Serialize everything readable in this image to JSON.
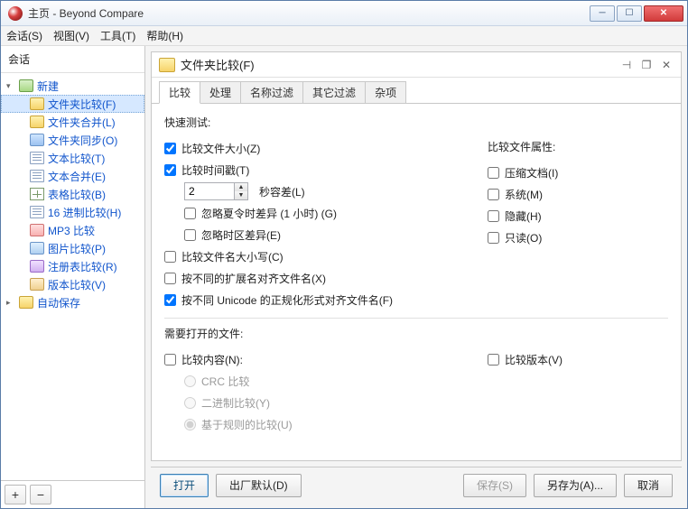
{
  "title": "主页 - Beyond Compare",
  "menu": {
    "session": "会话(S)",
    "view": "视图(V)",
    "tools": "工具(T)",
    "help": "帮助(H)"
  },
  "sidebar": {
    "header": "会话",
    "new": "新建",
    "autosave": "自动保存",
    "items": [
      "文件夹比较(F)",
      "文件夹合并(L)",
      "文件夹同步(O)",
      "文本比较(T)",
      "文本合并(E)",
      "表格比较(B)",
      "16 进制比较(H)",
      "MP3 比较",
      "图片比较(P)",
      "注册表比较(R)",
      "版本比较(V)"
    ]
  },
  "panel": {
    "title": "文件夹比较(F)",
    "tabs": [
      "比较",
      "处理",
      "名称过滤",
      "其它过滤",
      "杂项"
    ],
    "quick_test": "快速测试:",
    "compare_size": "比较文件大小(Z)",
    "compare_time": "比较时间戳(T)",
    "seconds_value": "2",
    "seconds_label": "秒容差(L)",
    "ignore_dst": "忽略夏令时差异 (1 小时) (G)",
    "ignore_tz": "忽略时区差异(E)",
    "compare_case": "比较文件名大小写(C)",
    "align_ext": "按不同的扩展名对齐文件名(X)",
    "align_unicode": "按不同 Unicode 的正规化形式对齐文件名(F)",
    "attr_label": "比较文件属性:",
    "attr_archive": "压缩文档(I)",
    "attr_system": "系统(M)",
    "attr_hidden": "隐藏(H)",
    "attr_readonly": "只读(O)",
    "need_open": "需要打开的文件:",
    "compare_content": "比较内容(N):",
    "crc": "CRC 比较",
    "binary": "二进制比较(Y)",
    "rules": "基于规则的比较(U)",
    "compare_version": "比较版本(V)"
  },
  "footer": {
    "open": "打开",
    "defaults": "出厂默认(D)",
    "save": "保存(S)",
    "saveas": "另存为(A)...",
    "cancel": "取消"
  }
}
